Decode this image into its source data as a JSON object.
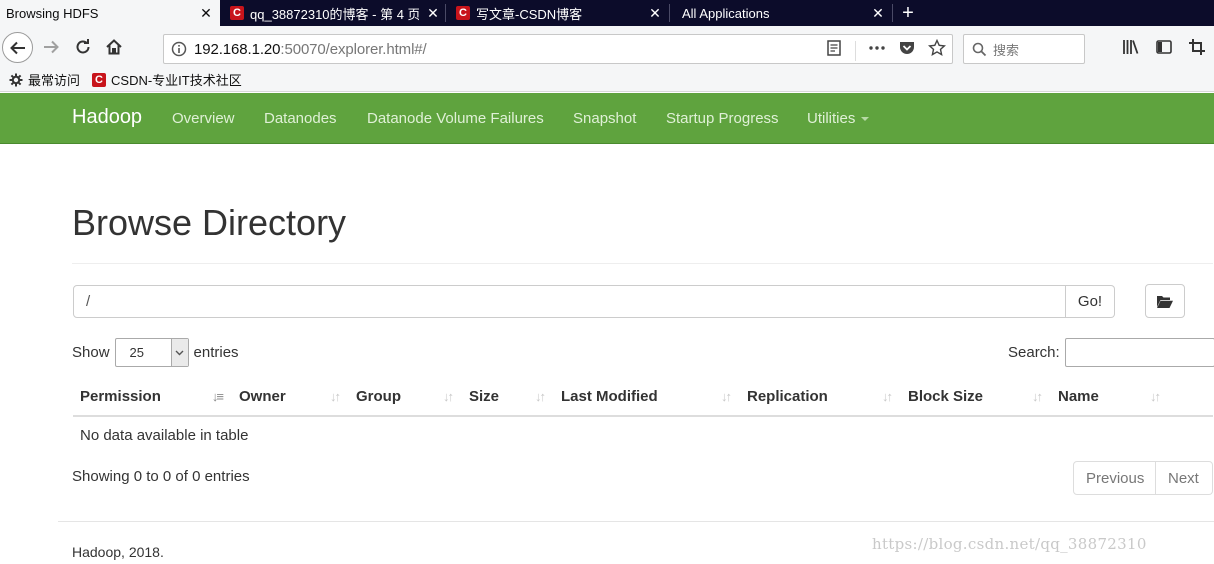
{
  "browser": {
    "tabs": [
      {
        "title": "Browsing HDFS",
        "close": "✕",
        "active": true,
        "has_favicon": false
      },
      {
        "title": "qq_38872310的博客 - 第 4 页",
        "close": "✕",
        "active": false,
        "has_favicon": true,
        "favicon": "C"
      },
      {
        "title": "写文章-CSDN博客",
        "close": "✕",
        "active": false,
        "has_favicon": true,
        "favicon": "C"
      },
      {
        "title": "All Applications",
        "close": "✕",
        "active": false,
        "has_favicon": false
      }
    ],
    "new_tab": "+",
    "url_host": "192.168.1.20",
    "url_rest": ":50070/explorer.html#/",
    "search_placeholder": "搜索",
    "bookmarks": [
      {
        "label": "最常访问",
        "icon": "gear-icon"
      },
      {
        "label": "CSDN-专业IT技术社区",
        "icon": "csdn-favicon",
        "favicon": "C"
      }
    ]
  },
  "hadoop_nav": {
    "brand": "Hadoop",
    "items": [
      "Overview",
      "Datanodes",
      "Datanode Volume Failures",
      "Snapshot",
      "Startup Progress",
      "Utilities"
    ]
  },
  "main": {
    "title": "Browse Directory",
    "path_value": "/",
    "go_label": "Go!",
    "show_label": "Show",
    "entries_label": "entries",
    "page_length": "25",
    "search_label": "Search:",
    "columns": [
      "Permission",
      "Owner",
      "Group",
      "Size",
      "Last Modified",
      "Replication",
      "Block Size",
      "Name"
    ],
    "empty_message": "No data available in table",
    "info": "Showing 0 to 0 of 0 entries",
    "prev_label": "Previous",
    "next_label": "Next"
  },
  "footer": {
    "text": "Hadoop, 2018."
  },
  "watermark": "https://blog.csdn.net/qq_38872310",
  "colors": {
    "navbar_green": "#5fa33e",
    "tabbar_dark": "#0c0c2a",
    "csdn_red": "#c8141b"
  }
}
